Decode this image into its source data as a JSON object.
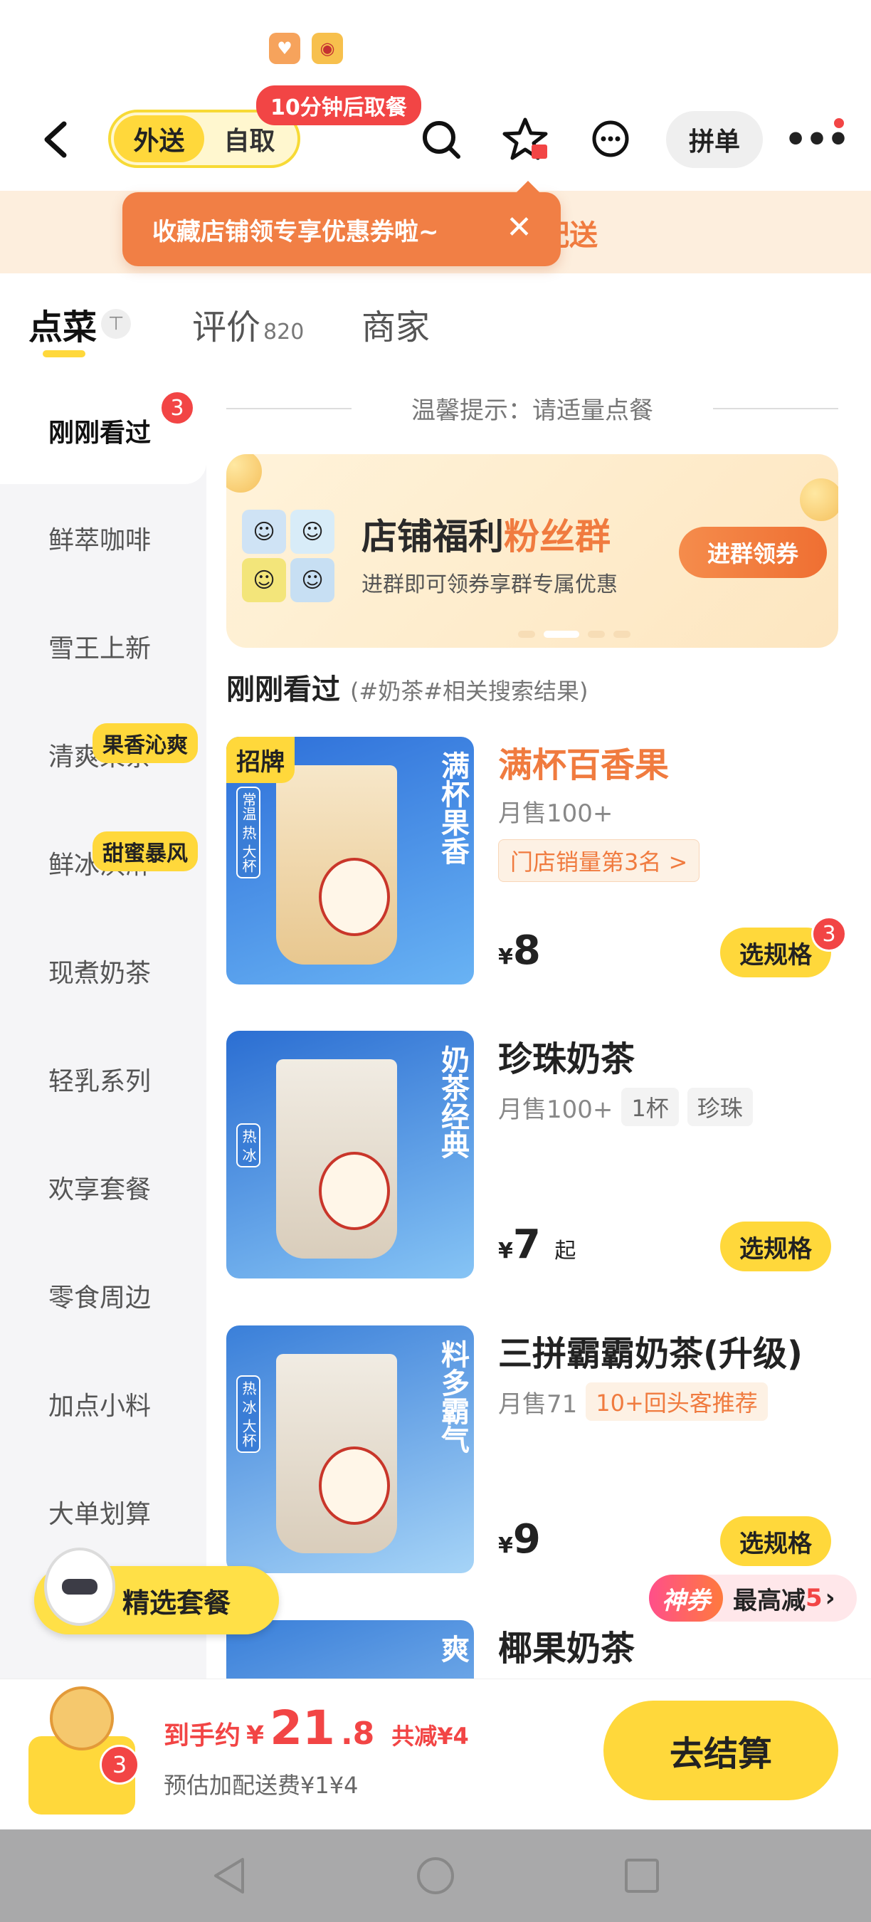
{
  "header": {
    "delivery_label": "外送",
    "pickup_label": "自取",
    "pickup_badge": "10分钟后取餐",
    "group_order_label": "拼单"
  },
  "promo": {
    "strip_text": "配送",
    "fav_tip": "收藏店铺领专享优惠券啦~"
  },
  "tabs": [
    {
      "label": "点菜"
    },
    {
      "label": "评价",
      "count": "820"
    },
    {
      "label": "商家"
    }
  ],
  "sidebar": {
    "items": [
      {
        "label": "刚刚看过",
        "badge": "3"
      },
      {
        "label": "鲜萃咖啡"
      },
      {
        "label": "雪王上新"
      },
      {
        "label": "清爽果茶",
        "tag": "果香沁爽"
      },
      {
        "label": "鲜冰淇淋",
        "tag": "甜蜜暴风"
      },
      {
        "label": "现煮奶茶"
      },
      {
        "label": "轻乳系列"
      },
      {
        "label": "欢享套餐"
      },
      {
        "label": "零食周边"
      },
      {
        "label": "加点小料"
      },
      {
        "label": "大单划算"
      }
    ]
  },
  "content": {
    "tip": "温馨提示：请适量点餐",
    "banner": {
      "title_a": "店铺福利",
      "title_b": "粉丝群",
      "subtitle": "进群即可领券享群专属优惠",
      "button": "进群领券"
    },
    "section_title": "刚刚看过",
    "section_sub": "(#奶茶#相关搜索结果)",
    "products": [
      {
        "name": "满杯百香果",
        "sales": "月售100+",
        "rank": "门店销量第3名 >",
        "price": "8",
        "spec_label": "选规格",
        "spec_badge": "3",
        "brand_tag": "招牌",
        "slogan": "满杯果香",
        "temp": "常温 热 大杯"
      },
      {
        "name": "珍珠奶茶",
        "sales": "月售100+",
        "chips": [
          "1杯",
          "珍珠"
        ],
        "price": "7",
        "price_suffix": "起",
        "spec_label": "选规格",
        "slogan": "奶茶经典",
        "temp": "热 冰"
      },
      {
        "name": "三拼霸霸奶茶(升级)",
        "sales": "月售71",
        "chips": [
          "10+回头客推荐"
        ],
        "price": "9",
        "spec_label": "选规格",
        "slogan": "料多霸气",
        "temp": "热 冰 大杯"
      },
      {
        "name": "椰果奶茶",
        "slogan": "爽"
      }
    ],
    "currency": "¥"
  },
  "floats": {
    "combo_label": "精选套餐",
    "coupon_shen": "神券",
    "coupon_text": "最高减",
    "coupon_amount": "5"
  },
  "cart": {
    "badge": "3",
    "prefix": "到手约",
    "currency": "¥",
    "price_int": "21",
    "price_dec": ".8",
    "save": "共减¥4",
    "fee": "预估加配送费¥1¥4",
    "checkout": "去结算"
  },
  "colors": {
    "accent_yellow": "#ffd83b",
    "accent_orange": "#f07b3f",
    "badge_red": "#f24545"
  }
}
